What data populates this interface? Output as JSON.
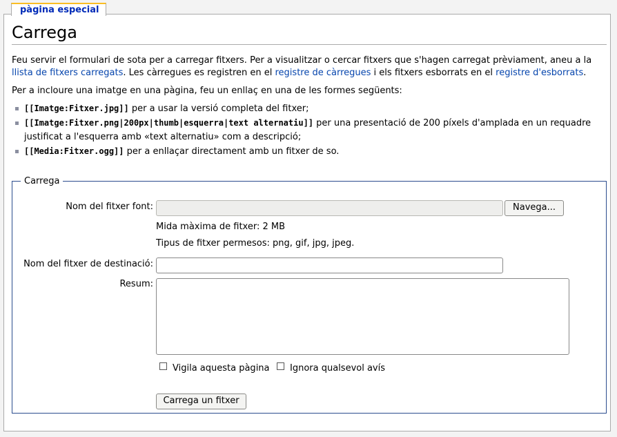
{
  "tab_label": "pàgina especial",
  "page_title": "Carrega",
  "intro": {
    "p1_before": "Feu servir el formulari de sota per a carregar fitxers. Per a visualitzar o cercar fitxers que s'hagen carregat prèviament, aneu a la ",
    "link_files": "llista de fitxers carregats",
    "p1_mid": ". Les càrregues es registren en el ",
    "link_upload_log": "registre de càrregues",
    "p1_mid2": " i els fitxers esborrats en el ",
    "link_delete_log": "registre d'esborrats",
    "p1_end": ".",
    "p2": "Per a incloure una imatge en una pàgina, feu un enllaç en una de les formes següents:"
  },
  "examples": [
    {
      "code": "[[Imatge:Fitxer.jpg]]",
      "text": " per a usar la versió completa del fitxer;"
    },
    {
      "code": "[[Imatge:Fitxer.png|200px|thumb|esquerra|text alternatiu]]",
      "text": " per una presentació de 200 píxels d'amplada en un requadre justificat a l'esquerra amb «text alternatiu» com a descripció;"
    },
    {
      "code": "[[Media:Fitxer.ogg]]",
      "text": " per a enllaçar directament amb un fitxer de so."
    }
  ],
  "form": {
    "legend": "Carrega",
    "source_label": "Nom del fitxer font:",
    "browse_button": "Navega...",
    "max_size": "Mida màxima de fitxer: 2 MB",
    "allowed_types": "Tipus de fitxer permesos: png, gif, jpg, jpeg.",
    "dest_label": "Nom del fitxer de destinació:",
    "summary_label": "Resum:",
    "watch_label": "Vigila aquesta pàgina",
    "ignore_label": "Ignora qualsevol avís",
    "submit_button": "Carrega un fitxer"
  }
}
